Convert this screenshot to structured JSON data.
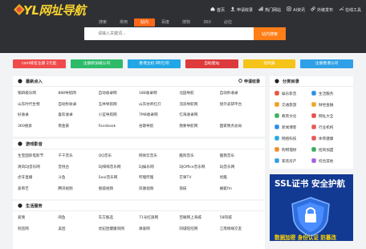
{
  "brand": {
    "name": "YL网址导航"
  },
  "topnav": [
    {
      "label": "首页",
      "icon": "home-icon"
    },
    {
      "label": "申请收录",
      "icon": "upload-icon"
    },
    {
      "label": "热门网站",
      "icon": "chart-icon"
    },
    {
      "label": "AI资讯",
      "icon": "ai-icon"
    },
    {
      "label": "外链发布",
      "icon": "link-icon"
    },
    {
      "label": "在线工具",
      "icon": "tool-icon"
    }
  ],
  "search": {
    "tabs": [
      "搜索",
      "常用",
      "站内",
      "百度",
      "搜狗",
      "360",
      "必应"
    ],
    "active_tab": 2,
    "placeholder": "请输入关键词...",
    "button": "站内搜索"
  },
  "promos": [
    {
      "label": "csm域名注册 2元起",
      "color": "#f04b4b"
    },
    {
      "label": "注册新加坡公司",
      "color": "#2dbb6a"
    },
    {
      "label": "香港主机 88元/年",
      "color": "#22a7e6"
    },
    {
      "label": "自助建站",
      "color": "#dd3b3b"
    },
    {
      "label": "招商集",
      "color": "#f6c318"
    },
    {
      "label": "注册香港公司",
      "color": "#2fa0e8"
    }
  ],
  "sections": [
    {
      "title": "最新点入",
      "more": "申请收录",
      "icon": "flame-icon",
      "items": [
        "钢四级乐网",
        "888导航网",
        "自动收录网",
        "188收录网",
        "北园导航",
        "自动秒收录",
        "山东时代生物",
        "自动秒收录",
        "玉林导航网",
        "山东仿师红灯",
        "流浪导航网",
        "接外卖研平台",
        "好收录",
        "喜欢收录",
        "小蓝导航网",
        "7M8收录网",
        "忆海收录网",
        "",
        "360搜索",
        "南金豪",
        "Facebook",
        "谷歌导航",
        "我要导航网",
        "国家税务总局"
      ]
    },
    {
      "title": "游戏影音",
      "more": "",
      "icon": "game-icon",
      "items": [
        "生宝国际电影节",
        "千千音乐",
        "QQ音乐",
        "网易云音乐",
        "酷狗音乐",
        "酷我音乐",
        "清风DJ音乐网",
        "音悦台",
        "DJ嗨嗨音乐网",
        "DJ娱乐网",
        "DJOffice音乐网",
        "DJ音乐网",
        "虎牙直播",
        "斗鱼",
        "Soul音乐网",
        "哔哩哔哩",
        "芒果TV",
        "优酷",
        "爱奇艺",
        "腾讯视频",
        "搜狐视频",
        "凤凰视频",
        "荔枝",
        "蜻蜓fm"
      ]
    },
    {
      "title": "生活服务",
      "more": "",
      "icon": "life-icon",
      "items": [
        "爱我",
        "闲鱼",
        "东方甄选",
        "71号红旗网",
        "百联网上海城",
        "58同城",
        "到店网",
        "美团",
        "优纪团健康资网",
        "驿爱网",
        "同城旺旺网",
        "江南情缘交友"
      ]
    }
  ],
  "categories": {
    "title": "分类目录",
    "items": [
      {
        "label": "娱乐影音",
        "icon": "film-icon",
        "color": "#e8513a"
      },
      {
        "label": "生活服务",
        "icon": "cart-icon",
        "color": "#2a8dee"
      },
      {
        "label": "交通旅游",
        "icon": "plane-icon",
        "color": "#f29c1f"
      },
      {
        "label": "财经金融",
        "icon": "money-icon",
        "color": "#f0a425"
      },
      {
        "label": "教育文化",
        "icon": "book-icon",
        "color": "#3fb15b"
      },
      {
        "label": "网址大全",
        "icon": "globe-icon",
        "color": "#e84b4b"
      },
      {
        "label": "新闻博客",
        "icon": "news-icon",
        "color": "#2f8bea"
      },
      {
        "label": "行业机构",
        "icon": "building-icon",
        "color": "#e65a5a"
      },
      {
        "label": "网络科技",
        "icon": "chip-icon",
        "color": "#27a7e0"
      },
      {
        "label": "体育健康",
        "icon": "heart-icon",
        "color": "#e85757"
      },
      {
        "label": "购物理财",
        "icon": "bag-icon",
        "color": "#f08b2c"
      },
      {
        "label": "招商加盟",
        "icon": "hand-icon",
        "color": "#3cab5e"
      },
      {
        "label": "家装房产",
        "icon": "house-icon",
        "color": "#2f9de3"
      },
      {
        "label": "综合其他",
        "icon": "grid-icon",
        "color": "#a25fe0"
      }
    ]
  },
  "ad": {
    "title": "SSL证书 安全护航",
    "subtitle": "数据加密 身份认证 防篡改"
  }
}
